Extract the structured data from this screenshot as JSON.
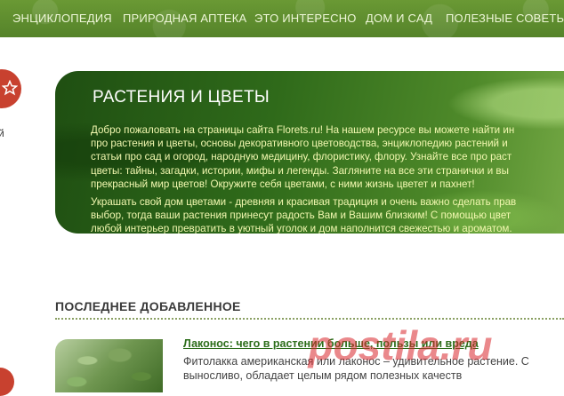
{
  "nav": {
    "items": [
      {
        "label": "ЭНЦИКЛОПЕДИЯ"
      },
      {
        "label": "ПРИРОДНАЯ АПТЕКА"
      },
      {
        "label": "ЭТО ИНТЕРЕСНО"
      },
      {
        "label": "ДОМ И САД"
      },
      {
        "label": "ПОЛЕЗНЫЕ СОВЕТЫ"
      }
    ]
  },
  "left": {
    "fragment_text": "й"
  },
  "hero": {
    "title": "РАСТЕНИЯ И ЦВЕТЫ",
    "paragraph1": [
      "Добро пожаловать на страницы сайта Florets.ru! На нашем ресурсе вы можете найти ин",
      "про растения и цветы, основы декоративного цветоводства, энциклопедию растений и",
      "статьи про сад и огород, народную медицину, флористику, флору. Узнайте все про раст",
      "цветы: тайны, загадки, истории, мифы и легенды. Загляните на все эти странички и вы",
      "прекрасный мир цветов! Окружите себя цветами, с ними жизнь цветет и пахнет!"
    ],
    "paragraph2": [
      "Украшать свой дом цветами - древняя и красивая традиция и очень важно сделать прав",
      "выбор, тогда ваши растения принесут радость Вам и Вашим близким! С помощью цвет",
      "любой интерьер превратить в уютный уголок и дом наполнится свежестью и ароматом."
    ]
  },
  "latest": {
    "title": "ПОСЛЕДНЕЕ ДОБАВЛЕННОЕ",
    "article": {
      "title": "Лаконос: чего в растении больше, пользы или вреда",
      "excerpt_lines": [
        "Фитолакка американская или лаконос – удивительное растение. С",
        "выносливо, обладает целым рядом полезных качеств"
      ]
    }
  },
  "watermark": {
    "text": "postila.ru"
  },
  "colors": {
    "nav_bg": "#5c8a2a",
    "hero_text": "#f2f8b0",
    "link": "#2c6d1a",
    "badge_red": "#c8412f",
    "watermark_red": "#d9262c"
  }
}
